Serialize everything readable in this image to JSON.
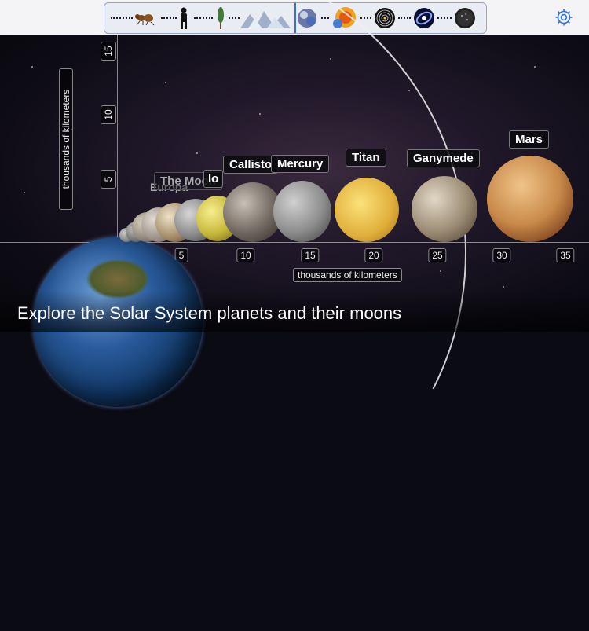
{
  "toolbar": {
    "strip_items": [
      "ant-icon",
      "person-icon",
      "tree-icon",
      "city-icon",
      "planets-icon",
      "sun-icon",
      "orbits-icon",
      "galaxy-icon",
      "universe-icon"
    ],
    "settings_icon": "gear-icon"
  },
  "chart": {
    "y_axis_label": "thousands of kilometers",
    "x_axis_label": "thousands of kilometers",
    "y_ticks": [
      "5",
      "10",
      "15"
    ],
    "x_ticks": [
      "5",
      "10",
      "15",
      "20",
      "25",
      "30",
      "35"
    ]
  },
  "bodies": {
    "europa": "Europa",
    "moon": "The Moon",
    "io": "Io",
    "callisto": "Callisto",
    "mercury": "Mercury",
    "titan": "Titan",
    "ganymede": "Ganymede",
    "mars": "Mars"
  },
  "caption": "Explore the Solar System planets and their moons",
  "colors": {
    "accent": "#3a6fd8",
    "axis": "#bbbbbb"
  }
}
